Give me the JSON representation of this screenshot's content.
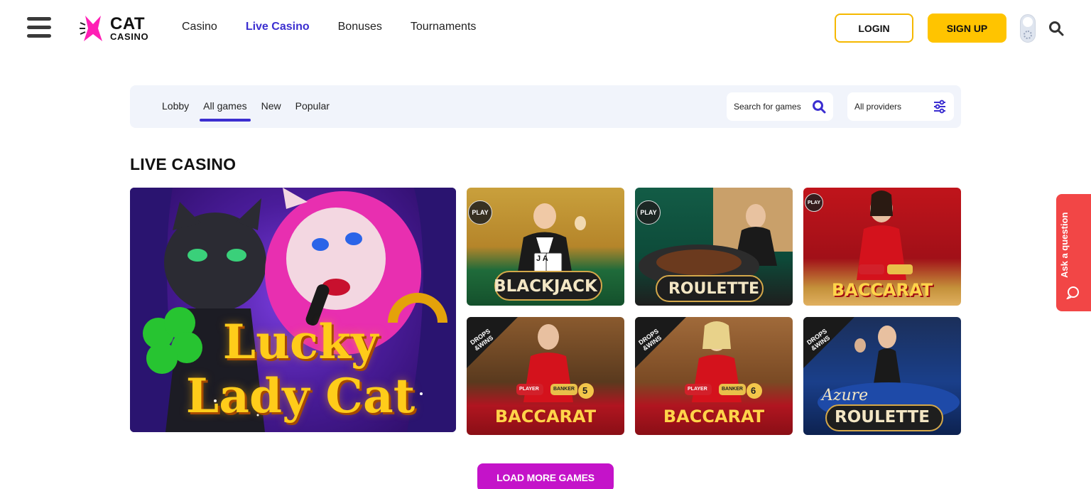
{
  "header": {
    "logo": {
      "line1": "CAT",
      "line2": "CASINO"
    },
    "nav": [
      {
        "label": "Casino",
        "active": false
      },
      {
        "label": "Live Casino",
        "active": true
      },
      {
        "label": "Bonuses",
        "active": false
      },
      {
        "label": "Tournaments",
        "active": false
      }
    ],
    "login_label": "LOGIN",
    "signup_label": "SIGN UP"
  },
  "filter_bar": {
    "tabs": [
      {
        "label": "Lobby",
        "active": false
      },
      {
        "label": "All games",
        "active": true
      },
      {
        "label": "New",
        "active": false
      },
      {
        "label": "Popular",
        "active": false
      }
    ],
    "search_placeholder": "Search for games",
    "providers_label": "All providers"
  },
  "section_title": "LIVE CASINO",
  "games": [
    {
      "name_line1": "Lucky",
      "name_line2": "Lady Cat",
      "badge": ""
    },
    {
      "name": "BLACKJACK",
      "badge": "PLAY",
      "card_text": "J A"
    },
    {
      "name": "ROULETTE",
      "badge": "PLAY"
    },
    {
      "name": "BACCARAT",
      "badge": "PLAY"
    },
    {
      "name": "BACCARAT",
      "badge_line1": "DROPS",
      "badge_line2": "&WINS",
      "number": "5",
      "player": "PLAYER",
      "banker": "BANKER"
    },
    {
      "name": "BACCARAT",
      "badge_line1": "DROPS",
      "badge_line2": "&WINS",
      "number": "6",
      "player": "PLAYER",
      "banker": "BANKER"
    },
    {
      "name_script": "Azure",
      "name": "ROULETTE",
      "badge_line1": "DROPS",
      "badge_line2": "&WINS"
    }
  ],
  "load_more_label": "LOAD MORE GAMES",
  "ask_label": "Ask a question",
  "colors": {
    "brand_purple": "#3b2ed0",
    "accent_yellow": "#ffc400",
    "load_more": "#c413c9",
    "ask_red": "#f24646"
  }
}
